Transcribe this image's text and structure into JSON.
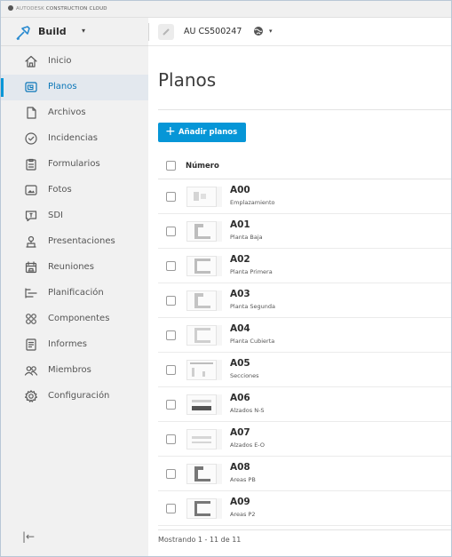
{
  "brand": {
    "prefix": "AUTODESK",
    "product": "CONSTRUCTION CLOUD"
  },
  "module": {
    "name": "Build",
    "caret": "▾"
  },
  "project": {
    "name": "AU CS500247",
    "caret": "▾"
  },
  "sidebar": {
    "items": [
      {
        "label": "Inicio",
        "icon": "home-icon"
      },
      {
        "label": "Planos",
        "icon": "sheets-icon",
        "active": true
      },
      {
        "label": "Archivos",
        "icon": "file-icon"
      },
      {
        "label": "Incidencias",
        "icon": "issues-icon"
      },
      {
        "label": "Formularios",
        "icon": "forms-icon"
      },
      {
        "label": "Fotos",
        "icon": "photos-icon"
      },
      {
        "label": "SDI",
        "icon": "rfi-icon"
      },
      {
        "label": "Presentaciones",
        "icon": "submittals-icon"
      },
      {
        "label": "Reuniones",
        "icon": "meetings-icon"
      },
      {
        "label": "Planificación",
        "icon": "schedule-icon"
      },
      {
        "label": "Componentes",
        "icon": "assets-icon"
      },
      {
        "label": "Informes",
        "icon": "reports-icon"
      },
      {
        "label": "Miembros",
        "icon": "members-icon"
      },
      {
        "label": "Configuración",
        "icon": "settings-icon"
      }
    ],
    "collapse_label": "|←"
  },
  "main": {
    "title": "Planos",
    "add_button": {
      "plus": "+",
      "label": "Añadir planos"
    },
    "table": {
      "column_header": "Número",
      "rows": [
        {
          "number": "A00",
          "title": "Emplazamiento"
        },
        {
          "number": "A01",
          "title": "Planta Baja"
        },
        {
          "number": "A02",
          "title": "Planta Primera"
        },
        {
          "number": "A03",
          "title": "Planta Segunda"
        },
        {
          "number": "A04",
          "title": "Planta Cubierta"
        },
        {
          "number": "A05",
          "title": "Secciones"
        },
        {
          "number": "A06",
          "title": "Alzados N-S"
        },
        {
          "number": "A07",
          "title": "Alzados E-O"
        },
        {
          "number": "A08",
          "title": "Areas PB"
        },
        {
          "number": "A09",
          "title": "Areas P2"
        }
      ]
    },
    "footer": "Mostrando 1 - 11 de 11"
  },
  "colors": {
    "accent": "#0696d7",
    "active_bg": "#e3e8ee",
    "sidebar_bg": "#f1f1f1"
  }
}
